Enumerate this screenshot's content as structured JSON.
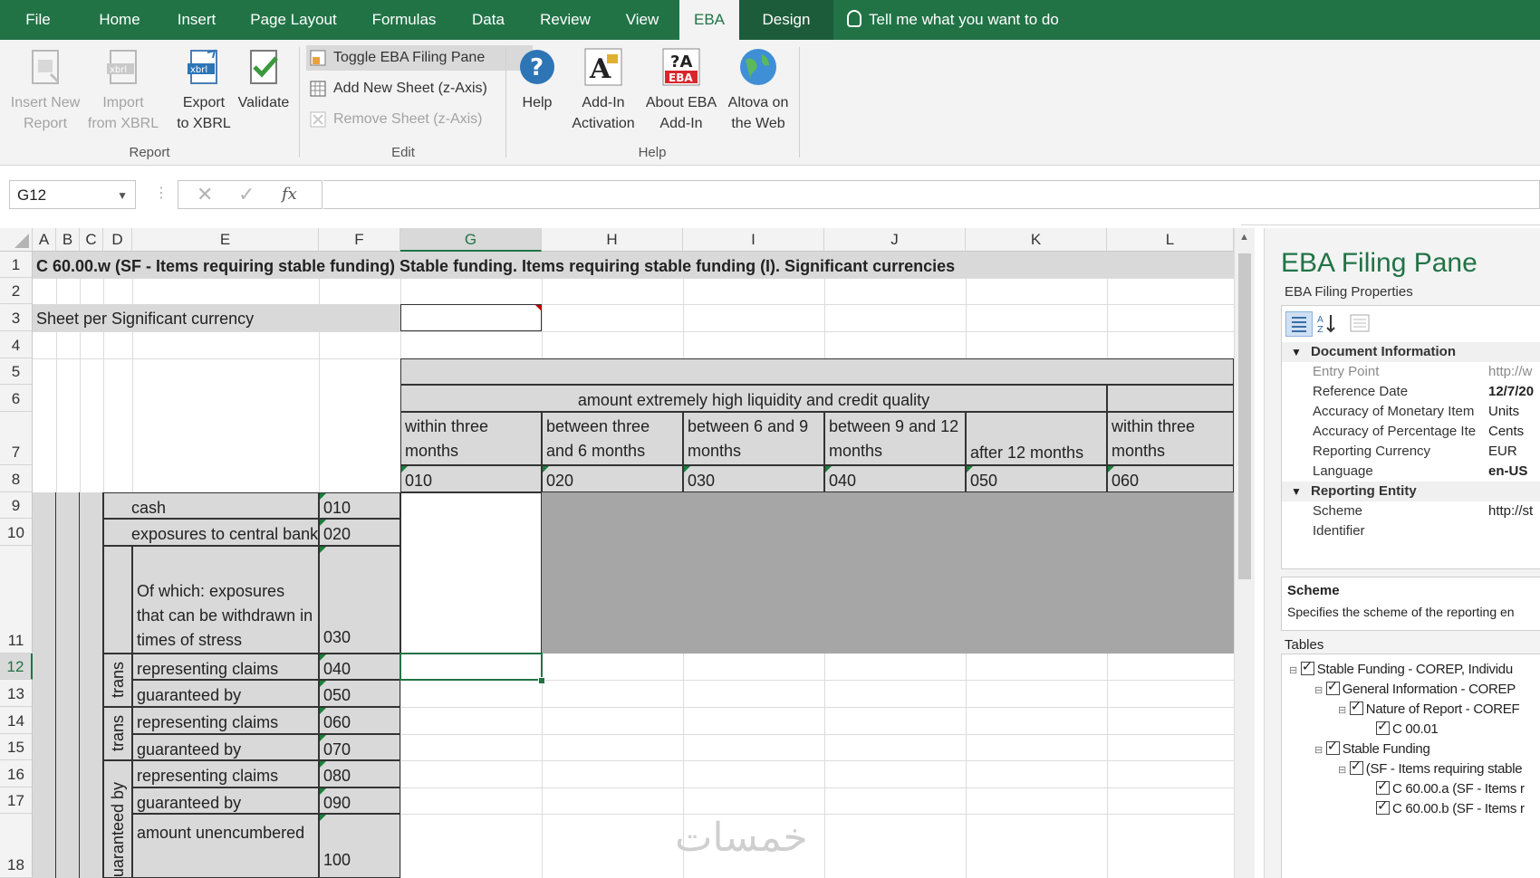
{
  "tabs": [
    "File",
    "Home",
    "Insert",
    "Page Layout",
    "Formulas",
    "Data",
    "Review",
    "View",
    "EBA",
    "Design"
  ],
  "tell_me": "Tell me what you want to do",
  "ribbon": {
    "report": {
      "insert_new": "Insert New Report",
      "import": "Import from XBRL",
      "export": "Export to XBRL",
      "validate": "Validate",
      "group": "Report"
    },
    "edit": {
      "toggle": "Toggle EBA Filing Pane",
      "add_sheet": "Add New Sheet (z-Axis)",
      "remove_sheet": "Remove Sheet (z-Axis)",
      "group": "Edit"
    },
    "help": {
      "help": "Help",
      "activation": "Add-In Activation",
      "about": "About EBA Add-In",
      "altova": "Altova on the Web",
      "group": "Help"
    }
  },
  "formula_bar": {
    "name_box": "G12",
    "fx": "fx",
    "value": ""
  },
  "columns": [
    "A",
    "B",
    "C",
    "D",
    "E",
    "F",
    "G",
    "H",
    "I",
    "J",
    "K",
    "L"
  ],
  "rows": [
    "1",
    "2",
    "3",
    "4",
    "5",
    "6",
    "7",
    "8",
    "9",
    "10",
    "11",
    "12",
    "13",
    "14",
    "15",
    "16",
    "17",
    "18"
  ],
  "sheet": {
    "title": "C 60.00.w (SF - Items requiring stable funding) Stable funding. Items requiring stable funding (I). Significant currencies",
    "sheet_label": "Sheet per Significant currency",
    "header_group": "amount extremely high liquidity and credit quality",
    "col_headers": [
      "within three months",
      "between three and 6 months",
      "between 6 and 9 months",
      "between 9 and 12 months",
      "after 12 months",
      "within three months"
    ],
    "col_codes": [
      "010",
      "020",
      "030",
      "040",
      "050",
      "060"
    ],
    "row_labels": [
      "cash",
      "exposures to central bank",
      "Of which: exposures that can be withdrawn in times of stress",
      "representing claims",
      "guaranteed by",
      "representing claims",
      "guaranteed by",
      "representing claims",
      "guaranteed by",
      "amount unencumbered"
    ],
    "row_codes": [
      "010",
      "020",
      "030",
      "040",
      "050",
      "060",
      "070",
      "080",
      "090",
      "100"
    ],
    "vertical_labels": [
      "trans",
      "trans",
      "uaranteed by"
    ]
  },
  "pane": {
    "title": "EBA Filing Pane",
    "subtitle": "EBA Filing Properties",
    "categories": {
      "doc": "Document Information",
      "entity": "Reporting Entity"
    },
    "props": [
      {
        "k": "Entry Point",
        "v": "http://w"
      },
      {
        "k": "Reference Date",
        "v": "12/7/20"
      },
      {
        "k": "Accuracy of Monetary Item",
        "v": "Units"
      },
      {
        "k": "Accuracy of Percentage Ite",
        "v": "Cents"
      },
      {
        "k": "Reporting Currency",
        "v": "EUR"
      },
      {
        "k": "Language",
        "v": "en-US"
      }
    ],
    "entity_props": [
      {
        "k": "Scheme",
        "v": "http://st"
      },
      {
        "k": "Identifier",
        "v": ""
      }
    ],
    "desc_title": "Scheme",
    "desc_text": "Specifies the scheme of the reporting en",
    "tables_label": "Tables",
    "tree": [
      "Stable Funding - COREP, Individu",
      "General Information - COREP",
      "Nature of Report - COREF",
      "C 00.01",
      "Stable Funding",
      "(SF - Items requiring stable",
      "C 60.00.a (SF - Items r",
      "C 60.00.b (SF - Items r"
    ]
  },
  "watermark": "خمسات",
  "colors": {
    "accent": "#217346",
    "header_gray": "#d9d9d9",
    "dark_gray": "#a6a6a6"
  }
}
